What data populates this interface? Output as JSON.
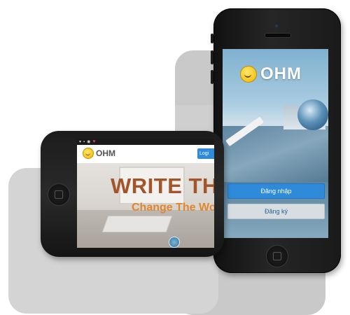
{
  "vertical_phone": {
    "brand": "OHM",
    "login_label": "Đăng nhập",
    "register_label": "Đăng ký"
  },
  "horizontal_phone": {
    "brand": "OHM",
    "login_label": "Logi",
    "headline": "WRITE THE CO",
    "subheadline": "Change The World"
  },
  "colors": {
    "brand_yellow": "#f2b600",
    "primary_blue": "#2f8ad9",
    "headline_brown": "#a2552a",
    "subheadline_orange": "#e0862c"
  }
}
